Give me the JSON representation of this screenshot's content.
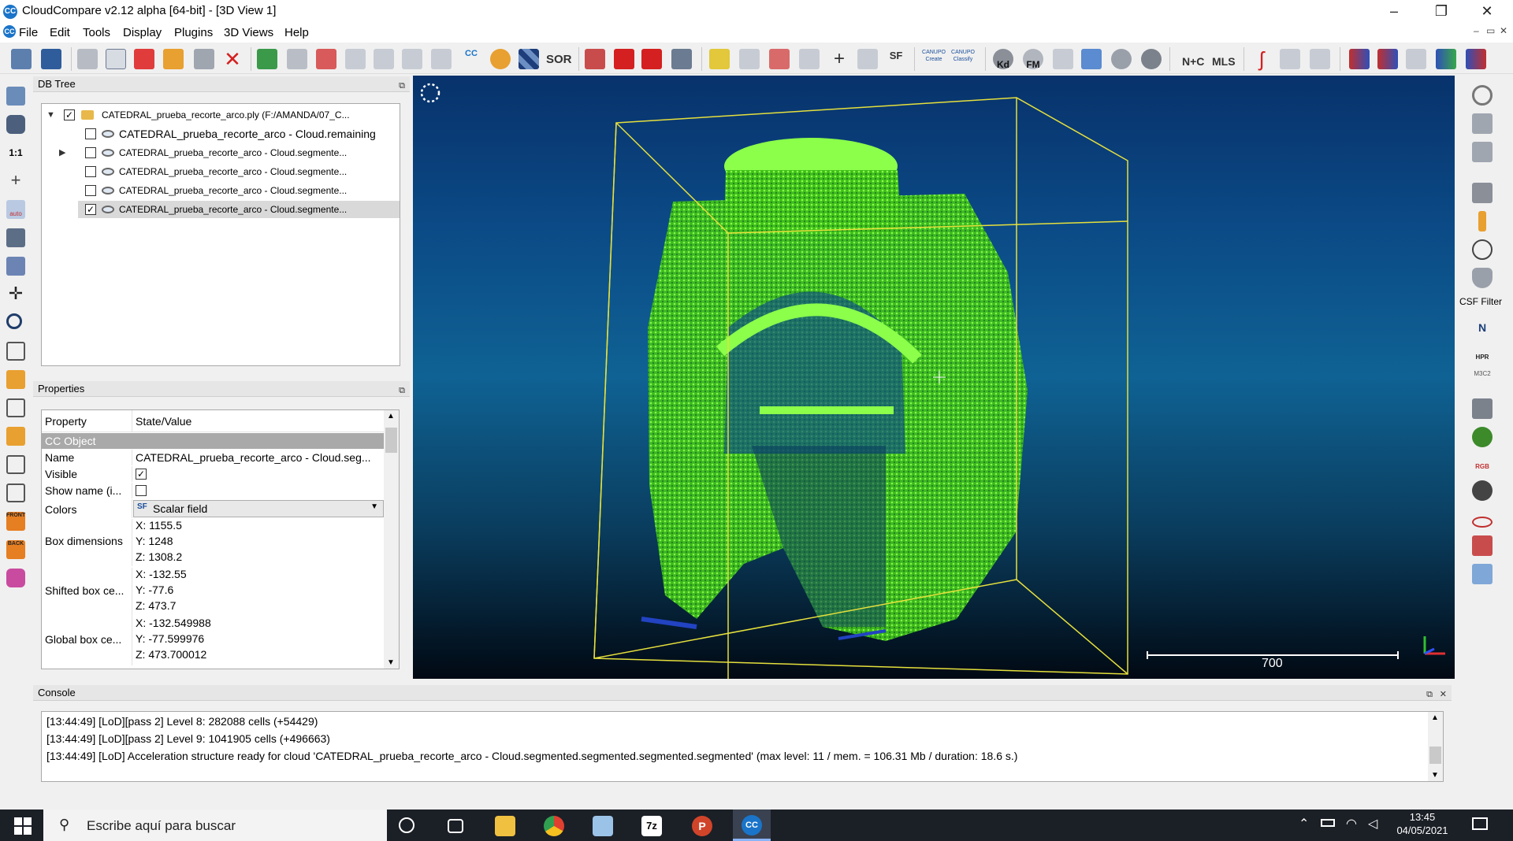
{
  "window": {
    "title": "CloudCompare v2.12 alpha [64-bit] - [3D View 1]",
    "logo": "CC",
    "controls": [
      "–",
      "❐",
      "✕"
    ]
  },
  "menu": {
    "items": [
      "File",
      "Edit",
      "Tools",
      "Display",
      "Plugins",
      "3D Views",
      "Help"
    ],
    "mdi_controls": [
      "–",
      "▭",
      "✕"
    ]
  },
  "toolbar": {
    "labels": {
      "cc": "CC",
      "sor": "SOR",
      "sf": "SF",
      "canupo_create": "CANUPO\nCreate",
      "canupo_classify": "CANUPO\nClassify",
      "kd": "Kd",
      "fm": "FM",
      "nc": "N+C",
      "mls": "MLS"
    }
  },
  "left_toolbar": {
    "scale_label": "1:1",
    "auto_label": "auto",
    "front_label": "FRONT",
    "back_label": "BACK"
  },
  "right_toolbar": {
    "csf_label": "CSF Filter",
    "n_label": "N",
    "hpr_label": "HPR",
    "m3c2_label": "M3C2",
    "rgb_label": "RGB"
  },
  "dbtree": {
    "title": "DB Tree",
    "root": {
      "label": "CATEDRAL_prueba_recorte_arco.ply (F:/AMANDA/07_C...",
      "checked": true
    },
    "children": [
      {
        "label": "CATEDRAL_prueba_recorte_arco - Cloud.remaining",
        "checked": false,
        "expandable": false
      },
      {
        "label": "CATEDRAL_prueba_recorte_arco - Cloud.segmente...",
        "checked": false,
        "expandable": true
      },
      {
        "label": "CATEDRAL_prueba_recorte_arco - Cloud.segmente...",
        "checked": false,
        "expandable": false
      },
      {
        "label": "CATEDRAL_prueba_recorte_arco - Cloud.segmente...",
        "checked": false,
        "expandable": false
      },
      {
        "label": "CATEDRAL_prueba_recorte_arco - Cloud.segmente...",
        "checked": true,
        "expandable": false,
        "selected": true
      }
    ]
  },
  "properties": {
    "title": "Properties",
    "header_property": "Property",
    "header_value": "State/Value",
    "section": "CC Object",
    "name_key": "Name",
    "name_value": "CATEDRAL_prueba_recorte_arco - Cloud.seg...",
    "visible_key": "Visible",
    "visible_checked": true,
    "showname_key": "Show name (i...",
    "showname_checked": false,
    "colors_key": "Colors",
    "colors_value": "Scalar field",
    "colors_icon": "SF",
    "boxdim_key": "Box dimensions",
    "boxdim": [
      "X: 1155.5",
      "Y: 1248",
      "Z: 1308.2"
    ],
    "shifted_key": "Shifted box ce...",
    "shifted": [
      "X: -132.55",
      "Y: -77.6",
      "Z: 473.7"
    ],
    "global_key": "Global box ce...",
    "global": [
      "X: -132.549988",
      "Y: -77.599976",
      "Z: 473.700012"
    ]
  },
  "view3d": {
    "scale_value": "700",
    "colors": {
      "cloud": "#54e61e",
      "bbox": "#e6e03c"
    }
  },
  "console": {
    "title": "Console",
    "lines": [
      "[13:44:49] [LoD][pass 2] Level 8: 282088 cells (+54429)",
      "[13:44:49] [LoD][pass 2] Level 9: 1041905 cells (+496663)",
      "[13:44:49] [LoD] Acceleration structure ready for cloud 'CATEDRAL_prueba_recorte_arco - Cloud.segmented.segmented.segmented.segmented' (max level: 11 / mem. = 106.31 Mb / duration: 18.6 s.)"
    ]
  },
  "taskbar": {
    "search_placeholder": "Escribe aquí para buscar",
    "time": "13:45",
    "date": "04/05/2021",
    "zip_label": "7z",
    "ppt_label": "P",
    "cc_label": "CC"
  }
}
